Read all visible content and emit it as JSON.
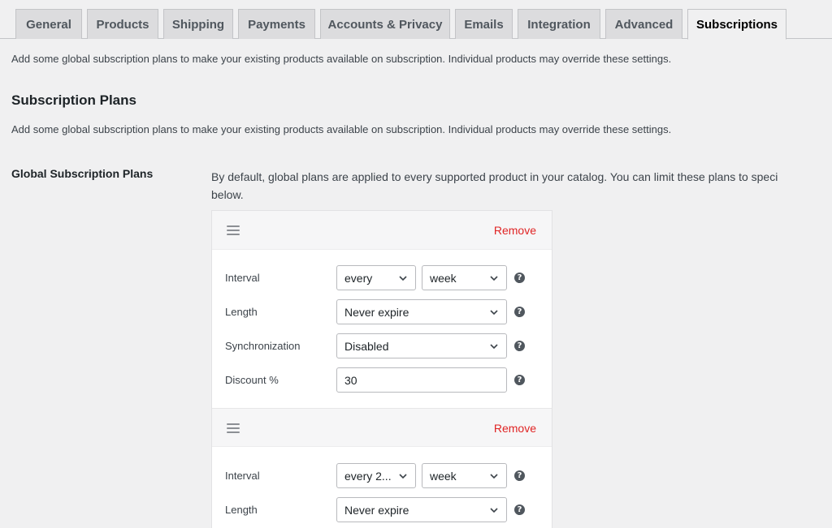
{
  "tabs": [
    {
      "label": "General"
    },
    {
      "label": "Products"
    },
    {
      "label": "Shipping"
    },
    {
      "label": "Payments"
    },
    {
      "label": "Accounts & Privacy"
    },
    {
      "label": "Emails"
    },
    {
      "label": "Integration"
    },
    {
      "label": "Advanced"
    },
    {
      "label": "Subscriptions",
      "active": true
    }
  ],
  "intro": "Add some global subscription plans to make your existing products available on subscription. Individual products may override these settings.",
  "section": {
    "title": "Subscription Plans",
    "description": "Add some global subscription plans to make your existing products available on subscription. Individual products may override these settings."
  },
  "field": {
    "label": "Global Subscription Plans",
    "description_line1": "By default, global plans are applied to every supported product in your catalog. You can limit these plans to speci",
    "description_line2": "below."
  },
  "plans": [
    {
      "remove_label": "Remove",
      "interval_label": "Interval",
      "interval_every": "every",
      "interval_period": "week",
      "length_label": "Length",
      "length_value": "Never expire",
      "sync_label": "Synchronization",
      "sync_value": "Disabled",
      "discount_label": "Discount %",
      "discount_value": "30"
    },
    {
      "remove_label": "Remove",
      "interval_label": "Interval",
      "interval_every": "every 2...",
      "interval_period": "week",
      "length_label": "Length",
      "length_value": "Never expire"
    }
  ],
  "help_glyph": "?",
  "colors": {
    "remove": "#e02424",
    "background": "#f0f0f1"
  }
}
